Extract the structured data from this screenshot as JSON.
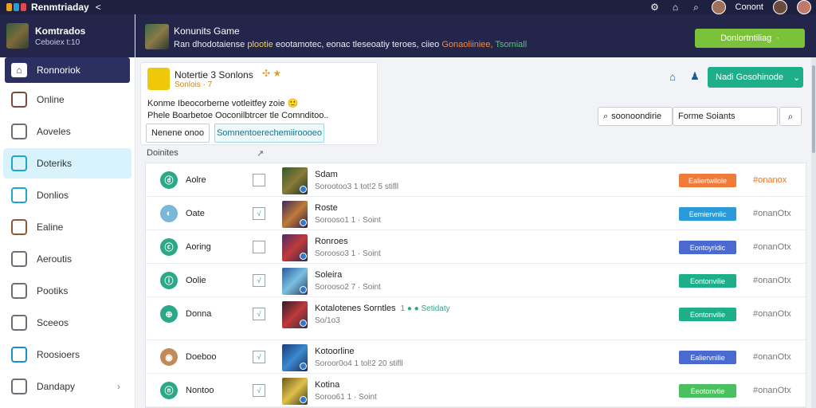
{
  "topbar": {
    "app_title": "Renmtriaday",
    "back_glyph": "<",
    "user_name": "Conont"
  },
  "sidebar": {
    "header_title": "Komtrados",
    "header_subtitle": "Ceboiex t:10",
    "home_label": "Ronnoriok",
    "items": [
      {
        "label": "Online",
        "icon": "user-avatar-icon",
        "color": "#7a4a3a"
      },
      {
        "label": "Aoveles",
        "icon": "doc-icon",
        "color": "#6b7078"
      },
      {
        "label": "Doteriks",
        "icon": "toggle-icon",
        "color": "#1aa7c9"
      },
      {
        "label": "Donlios",
        "icon": "chat-icon",
        "color": "#1aa7c9"
      },
      {
        "label": "Ealine",
        "icon": "game-icon",
        "color": "#8a5a3a"
      },
      {
        "label": "Aeroutis",
        "icon": "box-icon",
        "color": "#6b7078"
      },
      {
        "label": "Pootiks",
        "icon": "printer-icon",
        "color": "#6b7078"
      },
      {
        "label": "Sceeos",
        "icon": "doc-icon",
        "color": "#6b7078"
      },
      {
        "label": "Roosioers",
        "icon": "list-icon",
        "color": "#1a8fd0"
      },
      {
        "label": "Dandapy",
        "icon": "send-icon",
        "color": "#6b7078"
      }
    ]
  },
  "banner": {
    "title": "Konunits Game",
    "desc_white1": "Ran dhodotaiense ",
    "desc_yellow": "plootie",
    "desc_white2": " eootamotec, eonac tleseoatiy teroes, ciieo ",
    "desc_orange": "Gonaoliiniee,",
    "desc_green": " Tsomiall",
    "cta_label": "Donlortntiliag",
    "cta_dropdown": "·"
  },
  "profile": {
    "name": "Notertie 3 Sonlons",
    "badges": "✣ ★",
    "subtitle": "Sonlois · 7",
    "line1": "Konme Ibeocorberne votleitfey zoie 🙂",
    "line2": "Phele Boarbetoe Ooconilbtrcer tle Comnditoo..",
    "button1": "Nenene onoo",
    "button2": "Somnentoerechemiiroooeo"
  },
  "list": {
    "filter_label": "Doinites",
    "edit_glyph": "↗"
  },
  "controls": {
    "action_label": "Nadi Gosohinode",
    "action_chevron": "⌄",
    "search_label": "soonoondirie",
    "filter_value": "Forme Soiants",
    "search_btn_icon": "magnifier"
  },
  "rows": [
    {
      "icon_color": "#2aa888",
      "icon_glyph": "ⓓ",
      "name": "Aolre",
      "check": "",
      "thumb": "linear-gradient(135deg,#2f5a2a,#8a7a3a,#1f3a22)",
      "title": "Sdam",
      "meta": "Sorootoo3 1 tot!2 5 stifll",
      "extra": "",
      "status_label": "Ealiertwilole",
      "status_color": "#f07a3a",
      "link": "#onanox",
      "link_style": "orange"
    },
    {
      "icon_color": "#7ab8d8",
      "icon_glyph": "◐",
      "name": "Oate",
      "check": "√",
      "thumb": "linear-gradient(135deg,#3a2a5a,#c07a3a,#2a1a3a)",
      "title": "Roste",
      "meta": "Sorooso1 1 · Soint",
      "extra": "",
      "status_label": "Eemiervnlic",
      "status_color": "#2a9ad8",
      "link": "#onanOtx",
      "link_style": ""
    },
    {
      "icon_color": "#2aa888",
      "icon_glyph": "ⓒ",
      "name": "Aoring",
      "check": "",
      "thumb": "linear-gradient(135deg,#4a2a6a,#c03a3a,#2a2a4a)",
      "title": "Ronroes",
      "meta": "Sorooso3 1 · Soint",
      "extra": "",
      "status_label": "Eontoyridic",
      "status_color": "#4a6ad0",
      "link": "#onanOtx",
      "link_style": ""
    },
    {
      "icon_color": "#2aa888",
      "icon_glyph": "ⓘ",
      "name": "Oolie",
      "check": "√",
      "thumb": "linear-gradient(135deg,#2a5aa0,#7ac0e0,#2a3a6a)",
      "title": "Soleira",
      "meta": "Sorooso2 7 · Soint",
      "extra": "",
      "status_label": "Eontonvilie",
      "status_color": "#1fae8a",
      "link": "#onanOtx",
      "link_style": ""
    },
    {
      "icon_color": "#2aa888",
      "icon_glyph": "⊕",
      "name": "Donna",
      "check": "√",
      "thumb": "linear-gradient(135deg,#2a1a2a,#c03a3a,#3a2a3a)",
      "title": "Kotalotenes Sorntles",
      "meta": "So/1o3",
      "extra": "1 ● ● Setidaty",
      "status_label": "Eontonvilie",
      "status_color": "#1fae8a",
      "link": "#onanOtx",
      "link_style": ""
    },
    {
      "icon_color": "#c08a5a",
      "icon_glyph": "◉",
      "name": "Doeboo",
      "check": "√",
      "thumb": "linear-gradient(135deg,#1a3a7a,#3a8ad0,#1a2a5a)",
      "title": "Kotoorline",
      "meta": "Soroor0o4 1 tol!2 20 stifll",
      "extra": "",
      "status_label": "Ealiervnilie",
      "status_color": "#4a6ad0",
      "link": "#onanOtx",
      "link_style": ""
    },
    {
      "icon_color": "#2aa888",
      "icon_glyph": "ⓝ",
      "name": "Nontoo",
      "check": "√",
      "thumb": "linear-gradient(135deg,#6a5a1a,#e0c04a,#3a3a1a)",
      "title": "Kotina",
      "meta": "Soroo61 1 · Soint",
      "extra": "",
      "status_label": "Eeotonvtie",
      "status_color": "#4ac060",
      "link": "#onanOtx",
      "link_style": ""
    }
  ],
  "colors": {
    "nav_dark": "#1e2040",
    "banner": "#23264a",
    "accent_green": "#7cc13a",
    "accent_teal": "#1fae8a"
  }
}
